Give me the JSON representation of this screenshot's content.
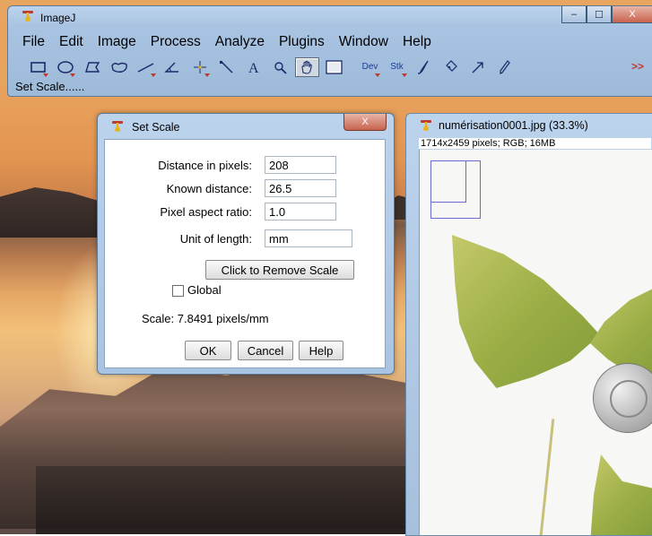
{
  "ij_window": {
    "title": "ImageJ",
    "menu": [
      "File",
      "Edit",
      "Image",
      "Process",
      "Analyze",
      "Plugins",
      "Window",
      "Help"
    ],
    "tools": [
      "rectangle-tool",
      "oval-tool",
      "polygon-tool",
      "freehand-tool",
      "line-tool",
      "angle-tool",
      "point-tool",
      "wand-tool",
      "text-tool",
      "magnifier-tool",
      "hand-tool",
      "color-picker-tool"
    ],
    "selected_tool": "hand-tool",
    "extra_tools": {
      "dev": "Dev",
      "stk": "Stk",
      "more": ">>"
    },
    "status": "Set Scale......",
    "window_controls": {
      "minimize": "–",
      "maximize": "☐",
      "close": "X"
    }
  },
  "image_window": {
    "title": "numérisation0001.jpg (33.3%)",
    "info": "1714x2459 pixels; RGB; 16MB"
  },
  "dialog": {
    "title": "Set Scale",
    "close": "X",
    "fields": {
      "distance_label": "Distance in pixels:",
      "distance_value": "208",
      "known_label": "Known distance:",
      "known_value": "26.5",
      "aspect_label": "Pixel aspect ratio:",
      "aspect_value": "1.0",
      "unit_label": "Unit of length:",
      "unit_value": "mm"
    },
    "remove_scale_button": "Click to Remove Scale",
    "global_label": "Global",
    "global_checked": false,
    "scale_text": "Scale: 7.8491 pixels/mm",
    "ok_button": "OK",
    "cancel_button": "Cancel",
    "help_button": "Help"
  },
  "colors": {
    "window_frame": "#a9c4e2",
    "close_button": "#c7634d",
    "accent_red": "#c0392b"
  }
}
